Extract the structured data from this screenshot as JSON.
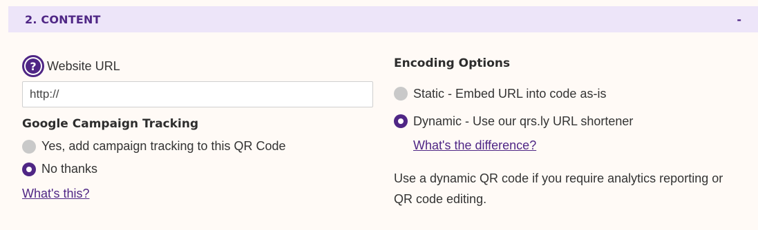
{
  "section": {
    "title": "2. CONTENT",
    "toggle": "-"
  },
  "url": {
    "label": "Website URL",
    "value": "http://",
    "help_icon": "help-icon"
  },
  "gct": {
    "heading": "Google Campaign Tracking",
    "options": [
      {
        "label": "Yes, add campaign tracking to this QR Code",
        "selected": false
      },
      {
        "label": "No thanks",
        "selected": true
      }
    ],
    "link": "What's this?"
  },
  "encoding": {
    "heading": "Encoding Options",
    "options": [
      {
        "label": "Static - Embed URL into code as-is",
        "selected": false
      },
      {
        "label": "Dynamic - Use our qrs.ly URL shortener",
        "selected": true
      }
    ],
    "link": "What's the difference?",
    "note": "Use a dynamic QR code if you require analytics reporting or QR code editing."
  },
  "colors": {
    "accent": "#4f2685",
    "header_bg": "#ede5f9",
    "page_bg": "#fffaf6",
    "radio_off": "#c9c9c9"
  }
}
